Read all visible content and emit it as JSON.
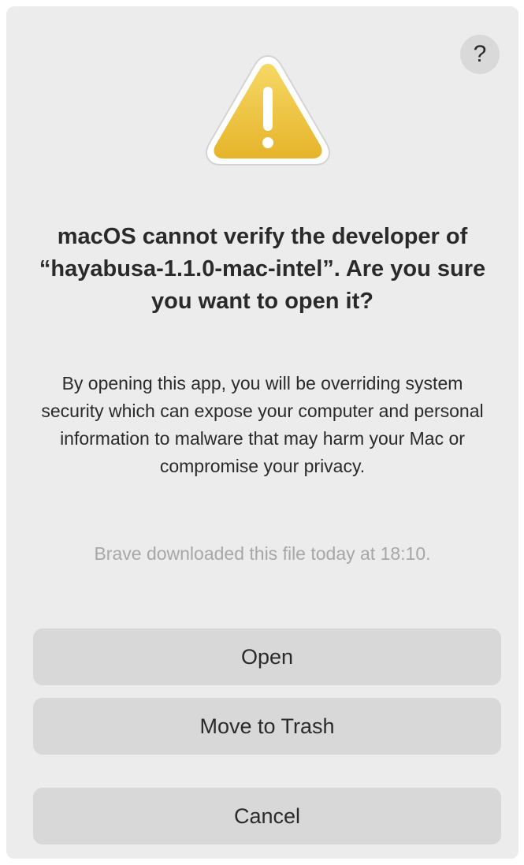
{
  "dialog": {
    "help_label": "?",
    "icon": "warning-triangle-icon",
    "title": "macOS cannot verify the developer of “hayabusa-1.1.0-mac-intel”. Are you sure you want to open it?",
    "message": "By opening this app, you will be overriding system security which can expose your computer and personal information to malware that may harm your Mac or compromise your privacy.",
    "download_note": "Brave downloaded this file today at 18:10.",
    "buttons": {
      "open": "Open",
      "move_to_trash": "Move to Trash",
      "cancel": "Cancel"
    }
  },
  "colors": {
    "dialog_background": "#ececec",
    "button_background": "#d8d8d8",
    "warning_yellow": "#f0c63a",
    "secondary_text": "#a7a7a7"
  }
}
